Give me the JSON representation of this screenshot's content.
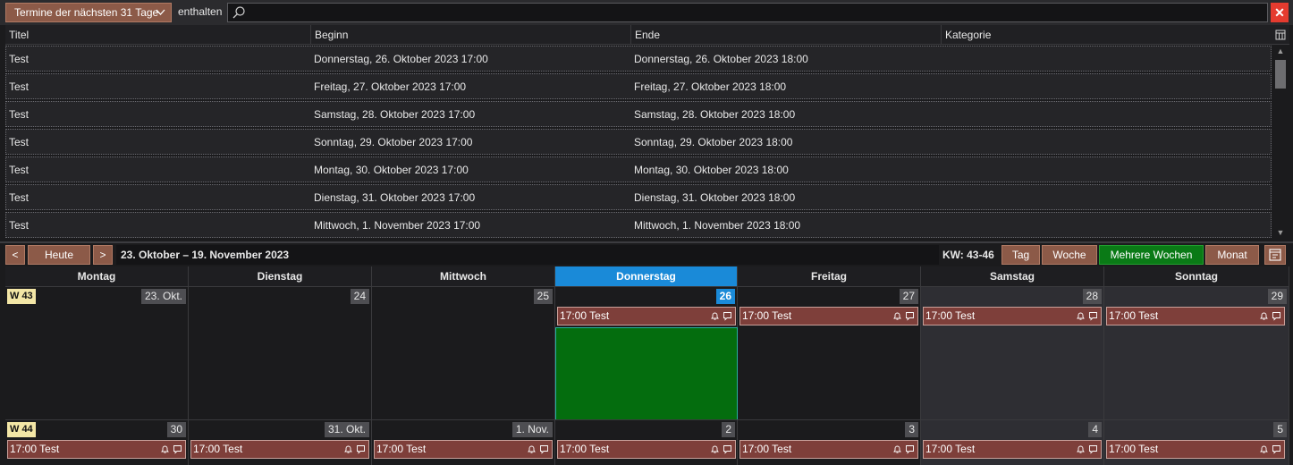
{
  "filter": {
    "range_select": "Termine der nächsten 31 Tage",
    "mode_label": "enthalten",
    "search_value": "",
    "clear_label": "✕"
  },
  "table": {
    "columns": [
      "Titel",
      "Beginn",
      "Ende",
      "Kategorie"
    ],
    "rows": [
      {
        "title": "Test",
        "begin": "Donnerstag, 26. Oktober 2023 17:00",
        "end": "Donnerstag, 26. Oktober 2023 18:00",
        "category": ""
      },
      {
        "title": "Test",
        "begin": "Freitag, 27. Oktober 2023 17:00",
        "end": "Freitag, 27. Oktober 2023 18:00",
        "category": ""
      },
      {
        "title": "Test",
        "begin": "Samstag, 28. Oktober 2023 17:00",
        "end": "Samstag, 28. Oktober 2023 18:00",
        "category": ""
      },
      {
        "title": "Test",
        "begin": "Sonntag, 29. Oktober 2023 17:00",
        "end": "Sonntag, 29. Oktober 2023 18:00",
        "category": ""
      },
      {
        "title": "Test",
        "begin": "Montag, 30. Oktober 2023 17:00",
        "end": "Montag, 30. Oktober 2023 18:00",
        "category": ""
      },
      {
        "title": "Test",
        "begin": "Dienstag, 31. Oktober 2023 17:00",
        "end": "Dienstag, 31. Oktober 2023 18:00",
        "category": ""
      },
      {
        "title": "Test",
        "begin": "Mittwoch, 1. November 2023 17:00",
        "end": "Mittwoch, 1. November 2023 18:00",
        "category": ""
      }
    ]
  },
  "calendar_toolbar": {
    "prev_label": "<",
    "today_label": "Heute",
    "next_label": ">",
    "range_label": "23. Oktober – 19. November 2023",
    "kw_label": "KW: 43-46",
    "views": {
      "day": "Tag",
      "week": "Woche",
      "multi": "Mehrere Wochen",
      "month": "Monat"
    },
    "active_view": "Mehrere Wochen"
  },
  "calendar": {
    "day_names": [
      "Montag",
      "Dienstag",
      "Mittwoch",
      "Donnerstag",
      "Freitag",
      "Samstag",
      "Sonntag"
    ],
    "today_index": 3,
    "weeks": [
      {
        "badge": "W 43",
        "dates": [
          "23. Okt.",
          "24",
          "25",
          "26",
          "27",
          "28",
          "29"
        ],
        "events": [
          "",
          "",
          "",
          "17:00 Test",
          "17:00 Test",
          "17:00 Test",
          "17:00 Test"
        ]
      },
      {
        "badge": "W 44",
        "dates": [
          "30",
          "31. Okt.",
          "1. Nov.",
          "2",
          "3",
          "4",
          "5"
        ],
        "events": [
          "17:00 Test",
          "17:00 Test",
          "17:00 Test",
          "17:00 Test",
          "17:00 Test",
          "17:00 Test",
          "17:00 Test"
        ]
      }
    ]
  },
  "colors": {
    "accent_button": "#8c5a48",
    "active_view": "#0a7a16",
    "today_blue": "#1a8ad8",
    "today_fill": "#046d0e",
    "event_bg": "#7e3f3a",
    "week_badge": "#f3e6a6",
    "close_red": "#e53b2f"
  }
}
